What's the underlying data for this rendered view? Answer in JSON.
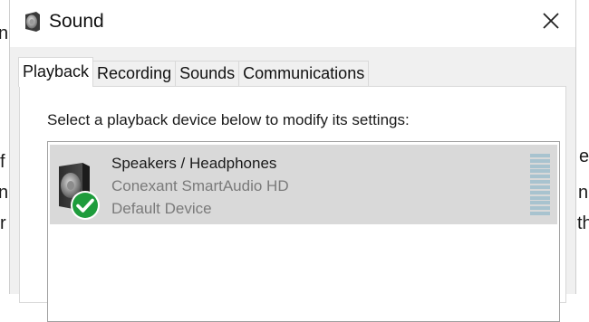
{
  "background_text": {
    "top_left": "n",
    "mid_left_1": "f",
    "mid_left_2": "n",
    "mid_left_3": "r",
    "right_1": "e",
    "right_2": "n",
    "right_3": "th"
  },
  "window": {
    "title": "Sound",
    "icon": "speaker-icon",
    "close_icon": "close-icon"
  },
  "tabs": [
    {
      "label": "Playback",
      "active": true
    },
    {
      "label": "Recording",
      "active": false
    },
    {
      "label": "Sounds",
      "active": false
    },
    {
      "label": "Communications",
      "active": false
    }
  ],
  "panel": {
    "instruction": "Select a playback device below to modify its settings:"
  },
  "devices": [
    {
      "name": "Speakers / Headphones",
      "driver": "Conexant SmartAudio HD",
      "status": "Default Device",
      "icon": "speaker-icon",
      "badge_icon": "checkmark-icon",
      "selected": true
    }
  ],
  "colors": {
    "selection": "#d9d9d9",
    "check_green": "#1e9c3c",
    "meter": "#a8c3cf"
  }
}
